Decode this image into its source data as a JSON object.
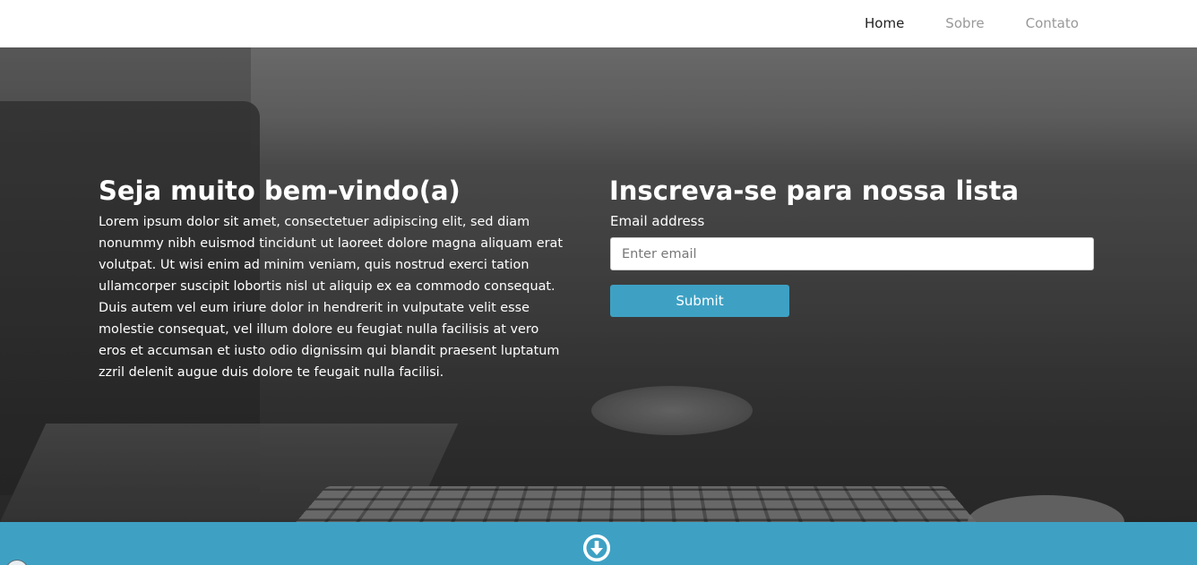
{
  "nav": {
    "items": [
      {
        "label": "Home",
        "active": true
      },
      {
        "label": "Sobre",
        "active": false
      },
      {
        "label": "Contato",
        "active": false
      }
    ]
  },
  "welcome": {
    "title": "Seja muito bem-vindo(a)",
    "text": "Lorem ipsum dolor sit amet, consectetuer adipiscing elit, sed diam nonummy nibh euismod tincidunt ut laoreet dolore magna aliquam erat volutpat. Ut wisi enim ad minim veniam, quis nostrud exerci tation ullamcorper suscipit lobortis nisl ut aliquip ex ea commodo consequat. Duis autem vel eum iriure dolor in hendrerit in vulputate velit esse molestie consequat, vel illum dolore eu feugiat nulla facilisis at vero eros et accumsan et iusto odio dignissim qui blandit praesent luptatum zzril delenit augue duis dolore te feugait nulla facilisi."
  },
  "signup": {
    "title": "Inscreva-se para nossa lista",
    "email_label": "Email address",
    "email_value": "",
    "email_placeholder": "Enter email",
    "submit_label": "Submit"
  },
  "icons": {
    "scroll": "arrow-down-circle-icon"
  },
  "colors": {
    "accent": "#3ea1c4",
    "nav_active": "#222222",
    "nav_inactive": "#999999"
  }
}
